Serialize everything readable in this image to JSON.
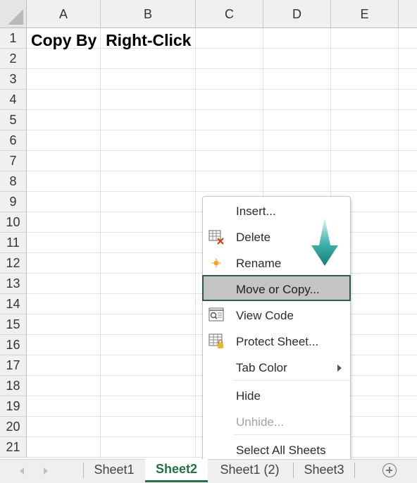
{
  "spreadsheet": {
    "columns": [
      "A",
      "B",
      "C",
      "D",
      "E"
    ],
    "rows": [
      "1",
      "2",
      "3",
      "4",
      "5",
      "6",
      "7",
      "8",
      "9",
      "10",
      "11",
      "12",
      "13",
      "14",
      "15",
      "16",
      "17",
      "18",
      "19",
      "20",
      "21"
    ],
    "cell_a1": "Copy By  Right-Click"
  },
  "context_menu": {
    "items": [
      {
        "label": "Insert...",
        "icon": "none",
        "enabled": true
      },
      {
        "label": "Delete",
        "icon": "delete-sheet-icon",
        "enabled": true
      },
      {
        "label": "Rename",
        "icon": "rename-icon",
        "enabled": true
      },
      {
        "label": "Move or Copy...",
        "icon": "none",
        "enabled": true,
        "highlighted": true
      },
      {
        "label": "View Code",
        "icon": "view-code-icon",
        "enabled": true
      },
      {
        "label": "Protect Sheet...",
        "icon": "protect-sheet-icon",
        "enabled": true
      },
      {
        "label": "Tab Color",
        "icon": "none",
        "enabled": true,
        "submenu": true
      },
      {
        "label": "Hide",
        "icon": "none",
        "enabled": true
      },
      {
        "label": "Unhide...",
        "icon": "none",
        "enabled": false
      },
      {
        "label": "Select All Sheets",
        "icon": "none",
        "enabled": true
      }
    ],
    "pointer_arrow_color": "#1f8f8c",
    "highlight_border_color": "#2d5a55"
  },
  "tabs": [
    {
      "label": "Sheet1",
      "active": false
    },
    {
      "label": "Sheet2",
      "active": true
    },
    {
      "label": "Sheet1 (2)",
      "active": false
    },
    {
      "label": "Sheet3",
      "active": false
    }
  ],
  "colors": {
    "active_tab": "#217346",
    "highlight_bg": "#c4c4c4"
  }
}
